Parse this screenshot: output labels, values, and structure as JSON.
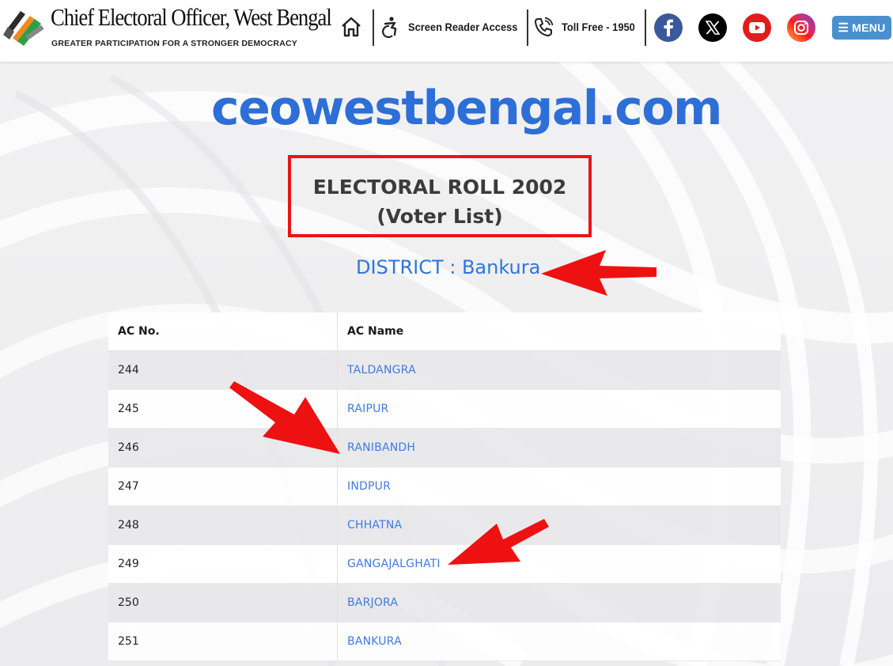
{
  "header": {
    "brand_title": "Chief Electoral Officer, West Bengal",
    "brand_tagline": "GREATER PARTICIPATION FOR A STRONGER DEMOCRACY",
    "screen_reader_label": "Screen Reader Access",
    "toll_free_label": "Toll Free - 1950",
    "menu_label": "MENU",
    "social": [
      "facebook-icon",
      "x-icon",
      "youtube-icon",
      "instagram-icon"
    ],
    "colors": {
      "facebook": "#3b5998",
      "x": "#000000",
      "youtube": "#e21b1b",
      "menu": "#4a90cf"
    }
  },
  "main": {
    "site_name": "ceowestbengal.com",
    "roll_title": "ELECTORAL ROLL 2002",
    "roll_subtitle": "(Voter List)",
    "district": "DISTRICT : Bankura",
    "table": {
      "headers": [
        "AC No.",
        "AC Name"
      ],
      "rows": [
        {
          "no": "244",
          "name": "TALDANGRA"
        },
        {
          "no": "245",
          "name": "RAIPUR"
        },
        {
          "no": "246",
          "name": "RANIBANDH"
        },
        {
          "no": "247",
          "name": "INDPUR"
        },
        {
          "no": "248",
          "name": "CHHATNA"
        },
        {
          "no": "249",
          "name": "GANGAJALGHATI"
        },
        {
          "no": "250",
          "name": "BARJORA"
        },
        {
          "no": "251",
          "name": "BANKURA"
        }
      ]
    },
    "colors": {
      "site_name": "#2d6fd6",
      "highlight_box": "#e8141b",
      "district": "#2f74e0",
      "link": "#3f7be0",
      "annotation_arrow": "#ee1111"
    }
  }
}
